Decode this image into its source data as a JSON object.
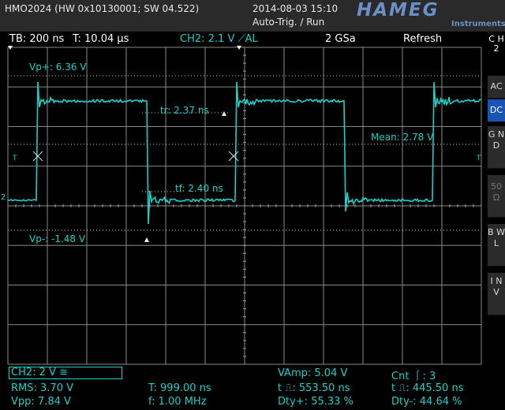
{
  "header": {
    "device": "HMO2024 (HW 0x10130001; SW 04.522)",
    "datetime": "2014-08-03 15:10",
    "trigger_mode": "Auto-Trig. / Run",
    "brand": "HAMEG",
    "brand_sub": "Instruments"
  },
  "status_bar": {
    "timebase": "TB: 200 ns",
    "trigger_time": "T: 10.04 µs",
    "channel_setting": "CH2: 2.1 V ⟋AL",
    "sample_rate": "2 GSa",
    "acq_mode": "Refresh"
  },
  "side_menu": {
    "title": "C H 2",
    "items": [
      {
        "label": "AC",
        "active": false
      },
      {
        "label": "DC",
        "active": true
      },
      {
        "label": "G N D",
        "active": false
      },
      {
        "label": "50 Ω",
        "active": false
      },
      {
        "label": "B W L",
        "active": false
      },
      {
        "label": "I N V",
        "active": false
      }
    ]
  },
  "annotations": {
    "vp_plus": "Vp+: 6.36 V",
    "vp_minus": "Vp-: -1.48 V",
    "rise": "tr: 2.37 ns",
    "fall": "tf: 2.40 ns",
    "mean": "Mean: 2.78 V",
    "marker_left": "T",
    "marker_right": "T",
    "ch_marker": "2"
  },
  "measurements": {
    "channel_box": "CH2: 2 V ≅",
    "rms": "RMS: 3.70 V",
    "vpp": "Vpp: 7.84 V",
    "period": "T: 999.00 ns",
    "freq": "f: 1.00 MHz",
    "vamp": "VAmp: 5.04 V",
    "pos_width": "t ⎍: 553.50 ns",
    "duty_pos": "Dty+: 55.33 %",
    "count": "Cnt ⎰: 3",
    "neg_width": "t ⎍: 445.50 ns",
    "duty_neg": "Dty-: 44.64 %"
  },
  "colors": {
    "trace": "#1ecfc8",
    "grid": "#8a8a8a",
    "active_button": "#1a55b5",
    "logo": "#6b8fc7"
  }
}
